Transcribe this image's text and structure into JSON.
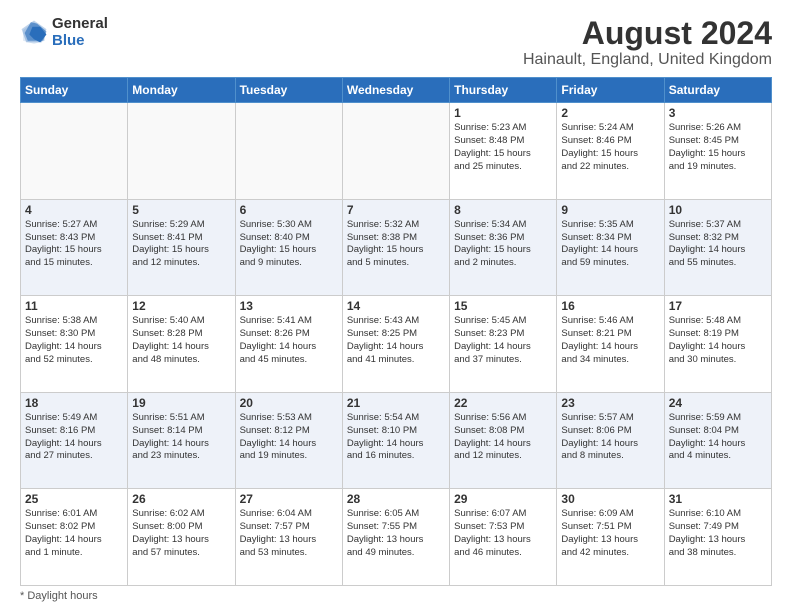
{
  "header": {
    "logo_general": "General",
    "logo_blue": "Blue",
    "title": "August 2024",
    "subtitle": "Hainault, England, United Kingdom"
  },
  "days_of_week": [
    "Sunday",
    "Monday",
    "Tuesday",
    "Wednesday",
    "Thursday",
    "Friday",
    "Saturday"
  ],
  "weeks": [
    [
      {
        "day": "",
        "info": ""
      },
      {
        "day": "",
        "info": ""
      },
      {
        "day": "",
        "info": ""
      },
      {
        "day": "",
        "info": ""
      },
      {
        "day": "1",
        "info": "Sunrise: 5:23 AM\nSunset: 8:48 PM\nDaylight: 15 hours\nand 25 minutes."
      },
      {
        "day": "2",
        "info": "Sunrise: 5:24 AM\nSunset: 8:46 PM\nDaylight: 15 hours\nand 22 minutes."
      },
      {
        "day": "3",
        "info": "Sunrise: 5:26 AM\nSunset: 8:45 PM\nDaylight: 15 hours\nand 19 minutes."
      }
    ],
    [
      {
        "day": "4",
        "info": "Sunrise: 5:27 AM\nSunset: 8:43 PM\nDaylight: 15 hours\nand 15 minutes."
      },
      {
        "day": "5",
        "info": "Sunrise: 5:29 AM\nSunset: 8:41 PM\nDaylight: 15 hours\nand 12 minutes."
      },
      {
        "day": "6",
        "info": "Sunrise: 5:30 AM\nSunset: 8:40 PM\nDaylight: 15 hours\nand 9 minutes."
      },
      {
        "day": "7",
        "info": "Sunrise: 5:32 AM\nSunset: 8:38 PM\nDaylight: 15 hours\nand 5 minutes."
      },
      {
        "day": "8",
        "info": "Sunrise: 5:34 AM\nSunset: 8:36 PM\nDaylight: 15 hours\nand 2 minutes."
      },
      {
        "day": "9",
        "info": "Sunrise: 5:35 AM\nSunset: 8:34 PM\nDaylight: 14 hours\nand 59 minutes."
      },
      {
        "day": "10",
        "info": "Sunrise: 5:37 AM\nSunset: 8:32 PM\nDaylight: 14 hours\nand 55 minutes."
      }
    ],
    [
      {
        "day": "11",
        "info": "Sunrise: 5:38 AM\nSunset: 8:30 PM\nDaylight: 14 hours\nand 52 minutes."
      },
      {
        "day": "12",
        "info": "Sunrise: 5:40 AM\nSunset: 8:28 PM\nDaylight: 14 hours\nand 48 minutes."
      },
      {
        "day": "13",
        "info": "Sunrise: 5:41 AM\nSunset: 8:26 PM\nDaylight: 14 hours\nand 45 minutes."
      },
      {
        "day": "14",
        "info": "Sunrise: 5:43 AM\nSunset: 8:25 PM\nDaylight: 14 hours\nand 41 minutes."
      },
      {
        "day": "15",
        "info": "Sunrise: 5:45 AM\nSunset: 8:23 PM\nDaylight: 14 hours\nand 37 minutes."
      },
      {
        "day": "16",
        "info": "Sunrise: 5:46 AM\nSunset: 8:21 PM\nDaylight: 14 hours\nand 34 minutes."
      },
      {
        "day": "17",
        "info": "Sunrise: 5:48 AM\nSunset: 8:19 PM\nDaylight: 14 hours\nand 30 minutes."
      }
    ],
    [
      {
        "day": "18",
        "info": "Sunrise: 5:49 AM\nSunset: 8:16 PM\nDaylight: 14 hours\nand 27 minutes."
      },
      {
        "day": "19",
        "info": "Sunrise: 5:51 AM\nSunset: 8:14 PM\nDaylight: 14 hours\nand 23 minutes."
      },
      {
        "day": "20",
        "info": "Sunrise: 5:53 AM\nSunset: 8:12 PM\nDaylight: 14 hours\nand 19 minutes."
      },
      {
        "day": "21",
        "info": "Sunrise: 5:54 AM\nSunset: 8:10 PM\nDaylight: 14 hours\nand 16 minutes."
      },
      {
        "day": "22",
        "info": "Sunrise: 5:56 AM\nSunset: 8:08 PM\nDaylight: 14 hours\nand 12 minutes."
      },
      {
        "day": "23",
        "info": "Sunrise: 5:57 AM\nSunset: 8:06 PM\nDaylight: 14 hours\nand 8 minutes."
      },
      {
        "day": "24",
        "info": "Sunrise: 5:59 AM\nSunset: 8:04 PM\nDaylight: 14 hours\nand 4 minutes."
      }
    ],
    [
      {
        "day": "25",
        "info": "Sunrise: 6:01 AM\nSunset: 8:02 PM\nDaylight: 14 hours\nand 1 minute."
      },
      {
        "day": "26",
        "info": "Sunrise: 6:02 AM\nSunset: 8:00 PM\nDaylight: 13 hours\nand 57 minutes."
      },
      {
        "day": "27",
        "info": "Sunrise: 6:04 AM\nSunset: 7:57 PM\nDaylight: 13 hours\nand 53 minutes."
      },
      {
        "day": "28",
        "info": "Sunrise: 6:05 AM\nSunset: 7:55 PM\nDaylight: 13 hours\nand 49 minutes."
      },
      {
        "day": "29",
        "info": "Sunrise: 6:07 AM\nSunset: 7:53 PM\nDaylight: 13 hours\nand 46 minutes."
      },
      {
        "day": "30",
        "info": "Sunrise: 6:09 AM\nSunset: 7:51 PM\nDaylight: 13 hours\nand 42 minutes."
      },
      {
        "day": "31",
        "info": "Sunrise: 6:10 AM\nSunset: 7:49 PM\nDaylight: 13 hours\nand 38 minutes."
      }
    ]
  ],
  "footer": "Daylight hours"
}
